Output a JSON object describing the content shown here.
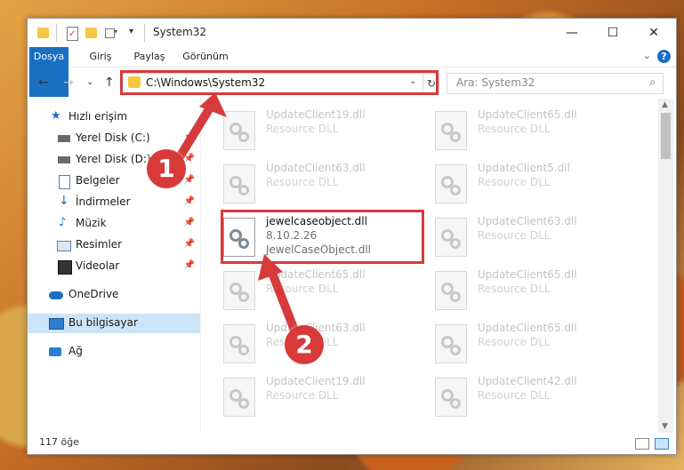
{
  "window": {
    "title": "System32",
    "controls": {
      "minimize": "—",
      "maximize": "☐",
      "close": "✕"
    }
  },
  "ribbon": {
    "tabs": [
      "Dosya",
      "Giriş",
      "Paylaş",
      "Görünüm"
    ],
    "help": "?"
  },
  "address": {
    "path": "C:\\Windows\\System32",
    "search_placeholder": "Ara: System32"
  },
  "nav": {
    "items": [
      {
        "label": "Hızlı erişim",
        "icon": "star-icon",
        "pinned": false
      },
      {
        "label": "Yerel Disk (C:)",
        "icon": "drive-icon",
        "pinned": true
      },
      {
        "label": "Yerel Disk (D:)",
        "icon": "drive-icon",
        "pinned": true
      },
      {
        "label": "Belgeler",
        "icon": "documents-icon",
        "pinned": true
      },
      {
        "label": "İndirmeler",
        "icon": "download-icon",
        "pinned": true
      },
      {
        "label": "Müzik",
        "icon": "music-icon",
        "pinned": true
      },
      {
        "label": "Resimler",
        "icon": "pictures-icon",
        "pinned": true
      },
      {
        "label": "Videolar",
        "icon": "videos-icon",
        "pinned": true
      },
      {
        "label": "OneDrive",
        "icon": "cloud-icon",
        "pinned": false
      },
      {
        "label": "Bu bilgisayar",
        "icon": "computer-icon",
        "pinned": false,
        "selected": true
      },
      {
        "label": "Ağ",
        "icon": "network-icon",
        "pinned": false
      }
    ]
  },
  "files": [
    {
      "name": "UpdateClient19.dll",
      "desc": "Resource DLL"
    },
    {
      "name": "UpdateClient65.dll",
      "desc": "Resource DLL"
    },
    {
      "name": "UpdateClient63.dll",
      "desc": "Resource DLL"
    },
    {
      "name": "UpdateClient5.dll",
      "desc": "Resource DLL"
    },
    {
      "name": "jewelcaseobject.dll",
      "desc": "8.10.2.26",
      "desc2": "JewelCaseObject.dll",
      "highlight": true
    },
    {
      "name": "UpdateClient63.dll",
      "desc": "Resource DLL"
    },
    {
      "name": "UpdateClient65.dll",
      "desc": "Resource DLL"
    },
    {
      "name": "UpdateClient65.dll",
      "desc": "Resource DLL"
    },
    {
      "name": "UpdateClient63.dll",
      "desc": "Resource DLL"
    },
    {
      "name": "UpdateClient65.dll",
      "desc": "Resource DLL"
    },
    {
      "name": "UpdateClient19.dll",
      "desc": "Resource DLL"
    },
    {
      "name": "UpdateClient42.dll",
      "desc": "Resource DLL"
    }
  ],
  "status": {
    "count": "117 öğe"
  },
  "callouts": [
    "1",
    "2"
  ],
  "colors": {
    "accent": "#1a6fc2",
    "annotation": "#d63b3b",
    "selection": "#cce4f7"
  }
}
